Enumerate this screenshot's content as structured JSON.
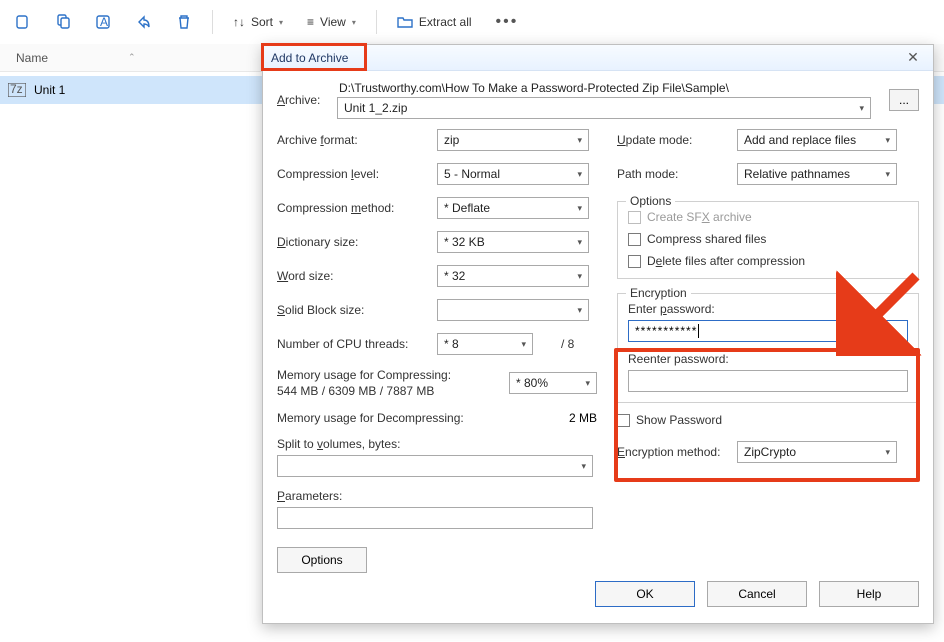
{
  "toolbar": {
    "sort_label": "Sort",
    "view_label": "View",
    "extract_label": "Extract all"
  },
  "list": {
    "col_name": "Name",
    "items": [
      {
        "label": "Unit 1"
      }
    ]
  },
  "dialog": {
    "title": "Add to Archive",
    "archive_label": "Archive:",
    "archive_path": "D:\\Trustworthy.com\\How To Make a Password-Protected Zip File\\Sample\\",
    "archive_filename": "Unit 1_2.zip",
    "browse_label": "...",
    "left": {
      "format_label": "Archive format:",
      "format_value": "zip",
      "level_label": "Compression level:",
      "level_value": "5 - Normal",
      "method_label": "Compression method:",
      "method_value": "* Deflate",
      "dict_label": "Dictionary size:",
      "dict_value": "* 32 KB",
      "word_label": "Word size:",
      "word_value": "* 32",
      "block_label": "Solid Block size:",
      "block_value": "",
      "threads_label": "Number of CPU threads:",
      "threads_value": "* 8",
      "threads_total": "/ 8",
      "mem_comp_label": "Memory usage for Compressing:",
      "mem_comp_sub": "544 MB / 6309 MB / 7887 MB",
      "mem_comp_value": "* 80%",
      "mem_decomp_label": "Memory usage for Decompressing:",
      "mem_decomp_value": "2 MB",
      "split_label": "Split to volumes, bytes:",
      "params_label": "Parameters:",
      "options_btn": "Options"
    },
    "right": {
      "update_label": "Update mode:",
      "update_value": "Add and replace files",
      "path_label": "Path mode:",
      "path_value": "Relative pathnames",
      "options_title": "Options",
      "sfx_label": "Create SFX archive",
      "shared_label": "Compress shared files",
      "delete_label": "Delete files after compression",
      "encryption_title": "Encryption",
      "enter_pw_label": "Enter password:",
      "enter_pw_value": "***********",
      "reenter_pw_label": "Reenter password:",
      "reenter_pw_value": "",
      "show_pw_label": "Show Password",
      "enc_method_label": "Encryption method:",
      "enc_method_value": "ZipCrypto"
    },
    "buttons": {
      "ok": "OK",
      "cancel": "Cancel",
      "help": "Help"
    }
  }
}
